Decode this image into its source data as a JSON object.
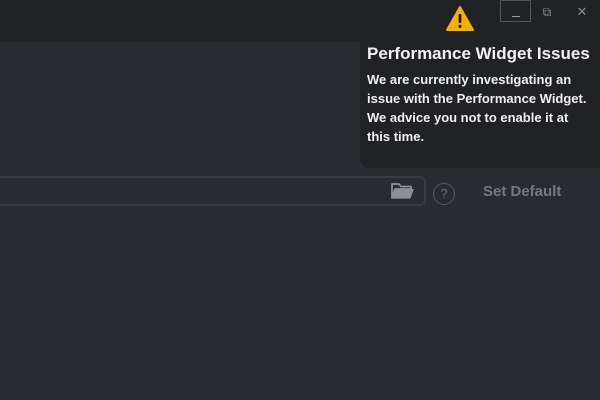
{
  "window_controls": {
    "restore_glyph": "⧉",
    "close_glyph": "✕"
  },
  "notice": {
    "icon": "warning-icon",
    "icon_color": "#f6b100",
    "title": "Performance Widget Issues",
    "message": "We are currently investigating an issue with the Performance Widget. We advice you not to enable it at this time."
  },
  "settings": {
    "path_value": "",
    "help_glyph": "?",
    "set_default_label": "Set Default"
  }
}
